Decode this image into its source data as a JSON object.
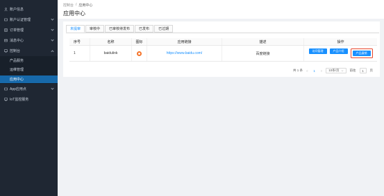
{
  "sidebar": {
    "items": [
      {
        "label": "账户信息",
        "icon": "user-icon"
      },
      {
        "label": "账户认证管理",
        "icon": "id-card-icon",
        "expandable": true
      },
      {
        "label": "订单管理",
        "icon": "order-icon",
        "expandable": true
      },
      {
        "label": "消息中心",
        "icon": "message-icon",
        "expandable": true
      },
      {
        "label": "控制台",
        "icon": "console-icon",
        "expandable": true,
        "expanded": true
      },
      {
        "label": "App应用点",
        "icon": "app-icon",
        "expandable": true
      },
      {
        "label": "IoT监控服务",
        "icon": "monitor-icon"
      }
    ],
    "console_sub": [
      {
        "label": "产品服务"
      },
      {
        "label": "运维管理"
      },
      {
        "label": "应用中心",
        "active": true
      }
    ]
  },
  "header": {
    "breadcrumb": [
      "控制台",
      "/",
      "应用中心"
    ],
    "title": "应用中心"
  },
  "tabs": [
    "未提审",
    "审核中",
    "已审核待发布",
    "已发布",
    "已过期"
  ],
  "active_tab": "未提审",
  "table": {
    "columns": [
      "序号",
      "名称",
      "图标",
      "应用链接",
      "描述",
      "操作"
    ],
    "rows": [
      {
        "index": "1",
        "name": "baidulink",
        "link": "https://www.baidu.com/",
        "desc": "百度链接",
        "actions": [
          "访问管理",
          "产品介绍",
          "产品展销"
        ]
      }
    ]
  },
  "pager": {
    "total": "共 1 条",
    "prev": "<",
    "page": "1",
    "next": ">",
    "page_size": "10条/页",
    "goto_label": "前往",
    "goto_value": "1",
    "goto_suffix": "页"
  },
  "colors": {
    "sidebar_bg": "#1f2733",
    "accent": "#1890ff",
    "highlight": "#e8452c",
    "icon_orange": "#f5742a"
  }
}
